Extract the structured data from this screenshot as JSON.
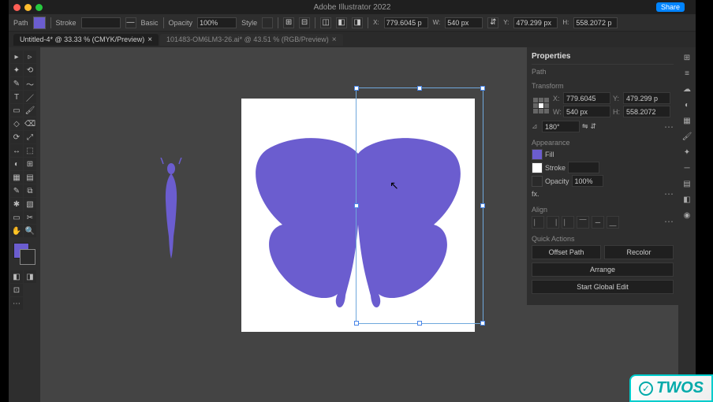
{
  "app": {
    "title": "Adobe Illustrator 2022",
    "share_label": "Share"
  },
  "control_bar": {
    "path_label": "Path",
    "stroke_label": "Stroke",
    "stroke_width": "",
    "basic_label": "Basic",
    "opacity_label": "Opacity",
    "opacity_value": "100%",
    "style_label": "Style",
    "x_value": "779.6045 p",
    "w_value": "540 px",
    "y_value": "479.299 px",
    "h_value": "558.2072 p"
  },
  "tabs": [
    {
      "label": "Untitled-4* @ 33.33 % (CMYK/Preview)"
    },
    {
      "label": "101483-OM6LM3-26.ai* @ 43.51 % (RGB/Preview)"
    }
  ],
  "properties_panel": {
    "title": "Properties",
    "selection_name": "Path",
    "transform": {
      "title": "Transform",
      "x": "779.6045",
      "y": "479.299 p",
      "w": "540 px",
      "h": "558.2072",
      "angle": "180°"
    },
    "appearance": {
      "title": "Appearance",
      "fill_label": "Fill",
      "stroke_label": "Stroke",
      "stroke_val": " ",
      "opacity_label": "Opacity",
      "opacity_value": "100%",
      "fx_label": "fx."
    },
    "align": {
      "title": "Align"
    },
    "quick_actions": {
      "title": "Quick Actions",
      "offset_path": "Offset Path",
      "recolor": "Recolor",
      "arrange": "Arrange",
      "start_global_edit": "Start Global Edit"
    }
  },
  "colors": {
    "accent_fill": "#6b5dcf"
  },
  "badge": {
    "text": "TWOS"
  }
}
